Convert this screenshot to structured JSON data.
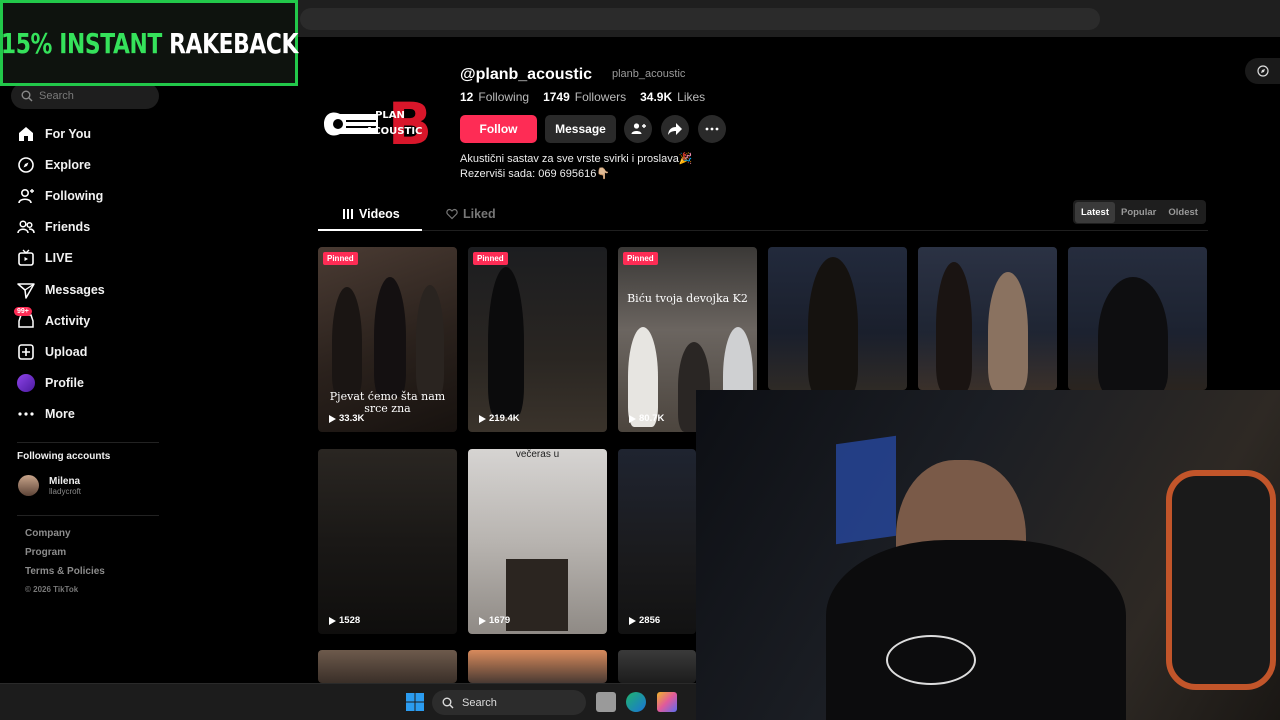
{
  "overlay": {
    "promo_green": "15% INSTANT",
    "promo_white": "RAKEBACK"
  },
  "sidebar": {
    "search_placeholder": "Search",
    "items": [
      {
        "label": "For You",
        "icon": "home-icon"
      },
      {
        "label": "Explore",
        "icon": "compass-icon"
      },
      {
        "label": "Following",
        "icon": "user-follow-icon"
      },
      {
        "label": "Friends",
        "icon": "friends-icon"
      },
      {
        "label": "LIVE",
        "icon": "live-icon"
      },
      {
        "label": "Messages",
        "icon": "paper-plane-icon"
      },
      {
        "label": "Activity",
        "icon": "inbox-icon",
        "badge": "99+"
      },
      {
        "label": "Upload",
        "icon": "upload-icon"
      },
      {
        "label": "Profile",
        "icon": "profile-avatar-icon"
      },
      {
        "label": "More",
        "icon": "more-icon"
      }
    ],
    "following_title": "Following accounts",
    "following": [
      {
        "name": "Milena",
        "handle": "lladycroft"
      }
    ],
    "footer": [
      "Company",
      "Program",
      "Terms & Policies"
    ],
    "copyright": "© 2026 TikTok"
  },
  "profile": {
    "logo_line1": "PLAN",
    "logo_line2": "ACOUSTIC",
    "logo_mark": "B",
    "handle": "@planb_acoustic",
    "nickname": "planb_acoustic",
    "following_count": "12",
    "following_label": "Following",
    "followers_count": "1749",
    "followers_label": "Followers",
    "likes_count": "34.9K",
    "likes_label": "Likes",
    "follow_button": "Follow",
    "message_button": "Message",
    "bio_line1": "Akustični sastav za sve vrste svirki i proslava🎉",
    "bio_line2": "Rezerviši sada: 069 695616👇🏼"
  },
  "tabs": {
    "videos": "Videos",
    "liked": "Liked"
  },
  "sort": {
    "latest": "Latest",
    "popular": "Popular",
    "oldest": "Oldest"
  },
  "videos": [
    {
      "pinned": "Pinned",
      "views": "33.3K",
      "caption": "Pjevat ćemo šta nam srce zna"
    },
    {
      "pinned": "Pinned",
      "views": "219.4K"
    },
    {
      "pinned": "Pinned",
      "views": "80.7K",
      "caption": "Biću tvoja devojka K2"
    },
    {},
    {},
    {},
    {
      "views": "1528"
    },
    {
      "views": "1679",
      "caption": "večeras u"
    },
    {
      "views": "2856"
    }
  ],
  "taskbar": {
    "search": "Search"
  },
  "colors": {
    "accent": "#fe2c55",
    "promo_green": "#35e25b",
    "background": "#000000"
  }
}
